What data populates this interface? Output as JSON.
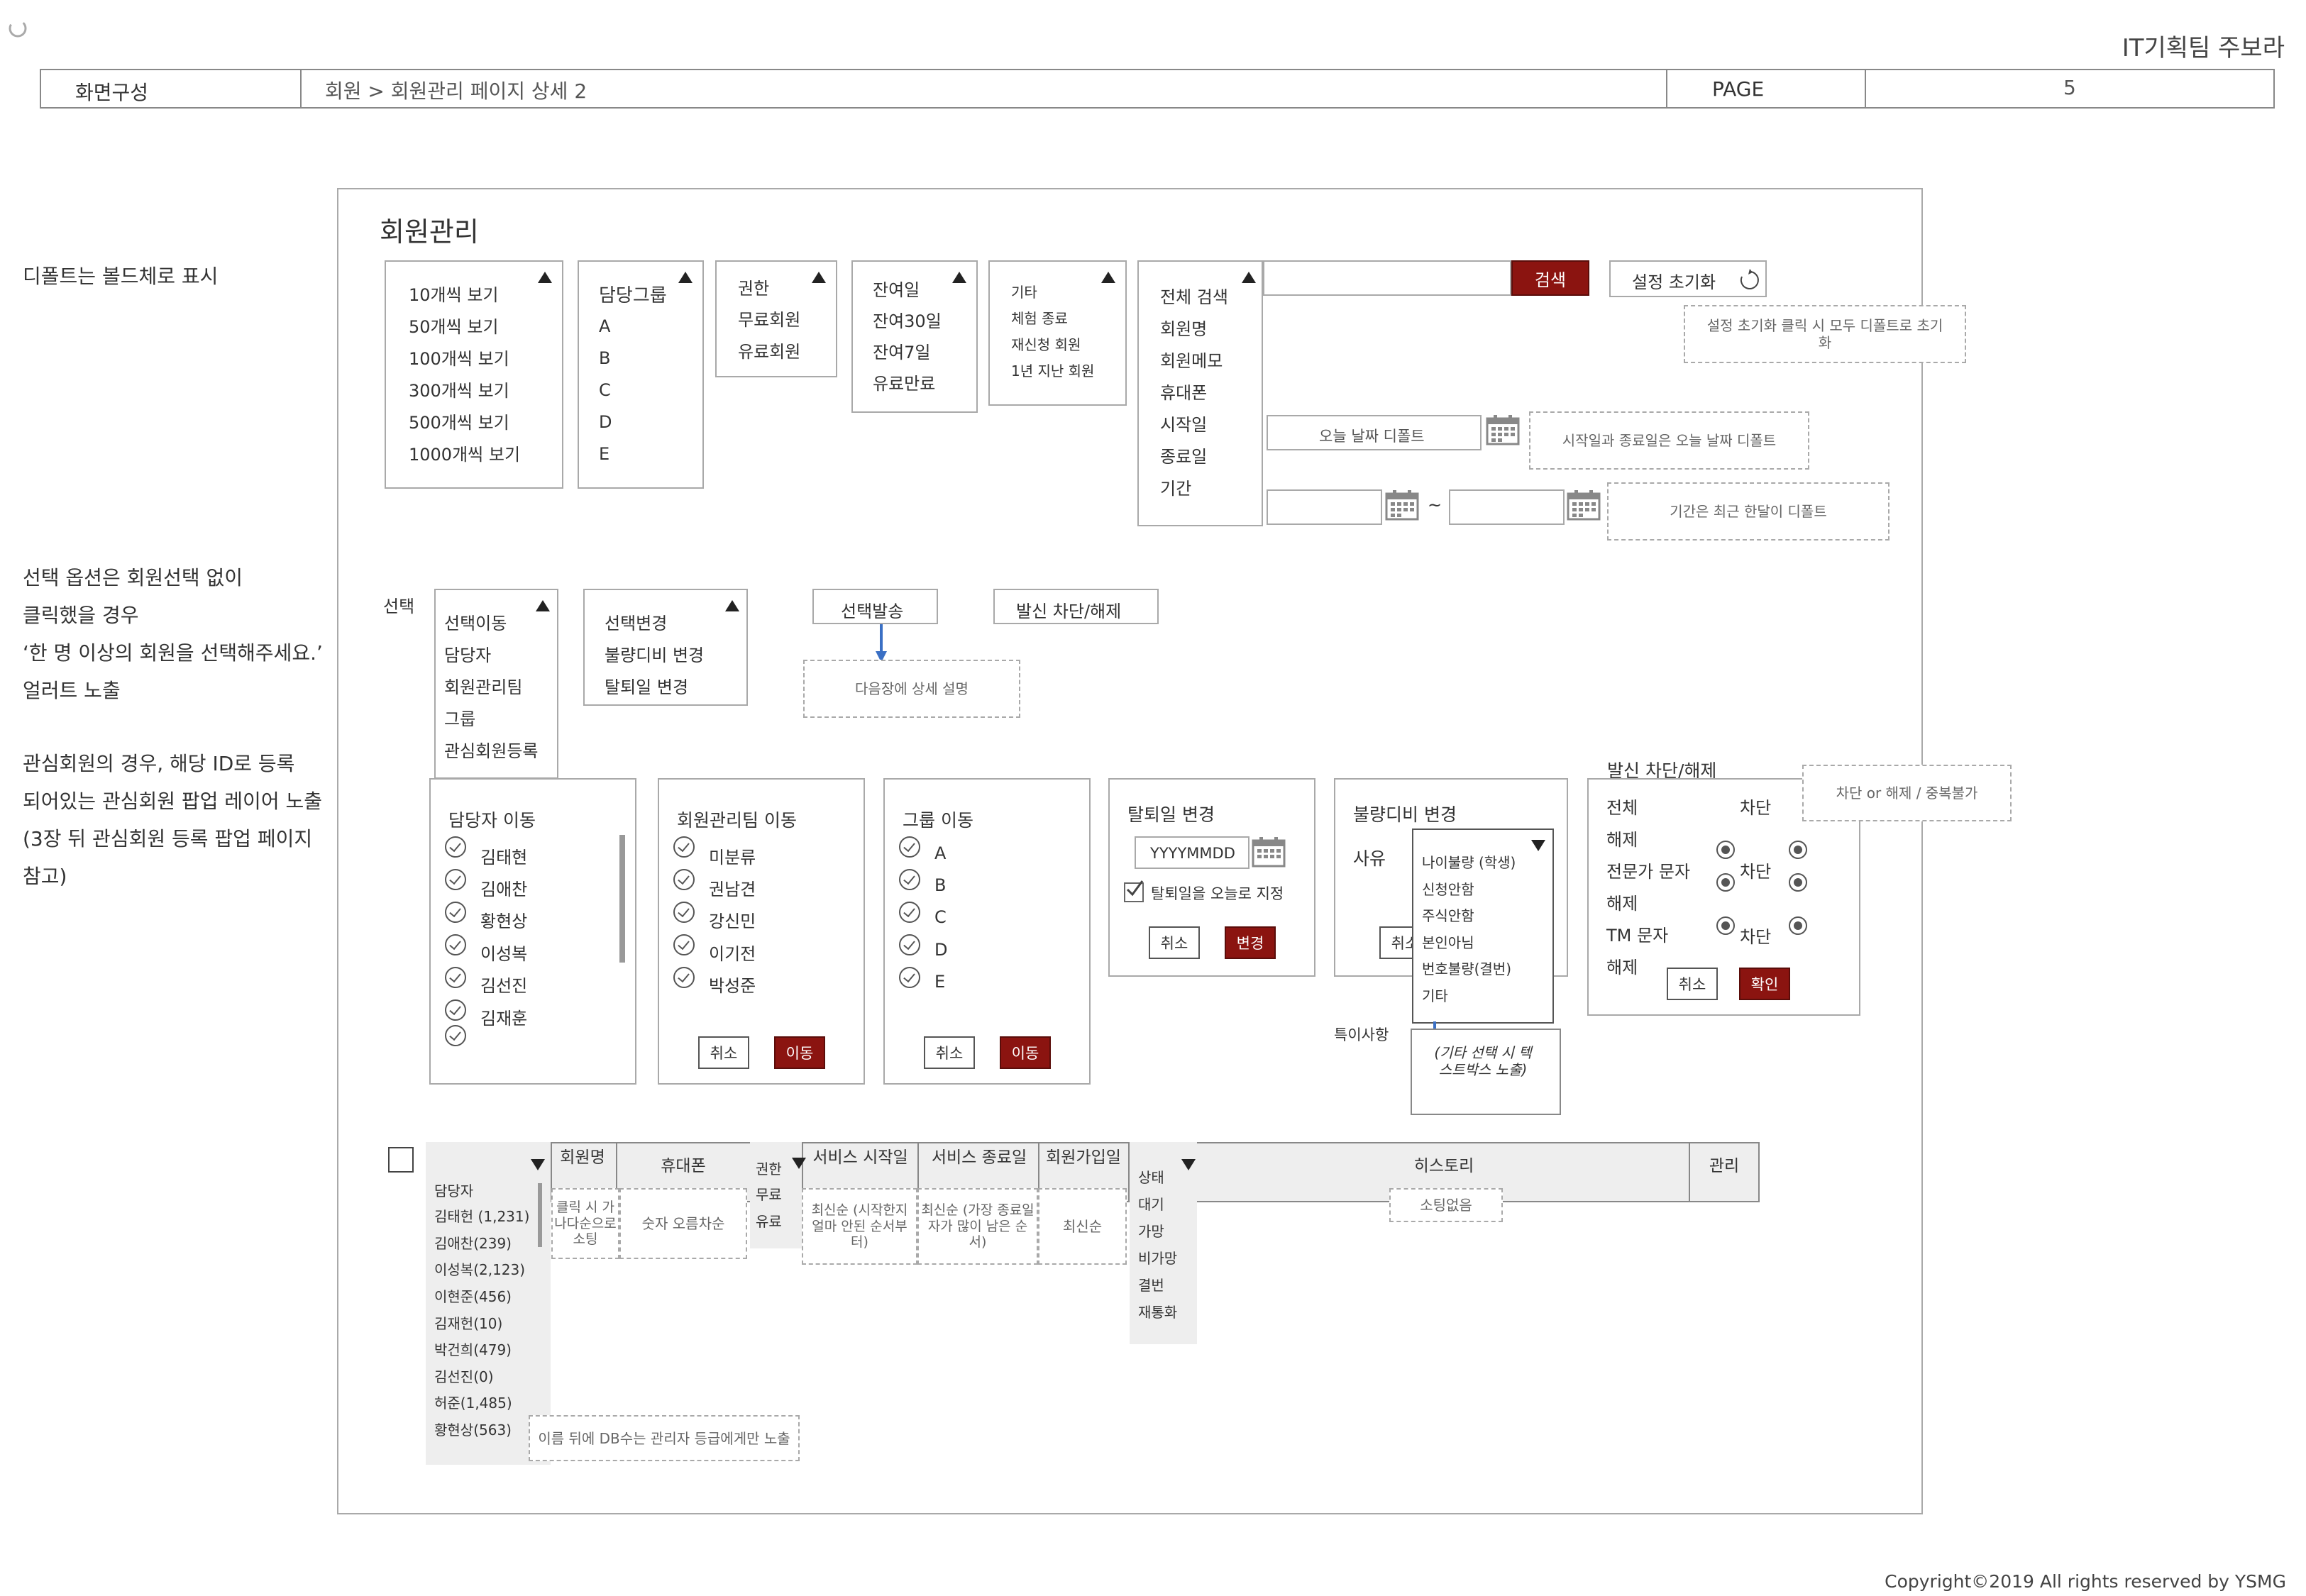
{
  "header": {
    "team": "IT기획팀 주보라",
    "screen_label": "화면구성",
    "breadcrumb": "회원 > 회원관리 페이지 상세 2",
    "page_label": "PAGE",
    "page_number": "5"
  },
  "notes": {
    "default_bold": "디폴트는 볼드체로 표시",
    "select_option": [
      "선택 옵션은 회원선택 없이",
      "클릭했을 경우",
      "‘한 명 이상의 회원을 선택해주세요.’",
      "얼러트 노출"
    ],
    "interest": [
      "관심회원의 경우, 해당 ID로 등록",
      "되어있는 관심회원 팝업 레이어 노출",
      "(3장 뒤 관심회원 등록 팝업 페이지",
      "참고)"
    ]
  },
  "panel_title": "회원관리",
  "filters": {
    "view_count": [
      "10개씩 보기",
      "50개씩 보기",
      "100개씩 보기",
      "300개씩 보기",
      "500개씩 보기",
      "1000개씩 보기"
    ],
    "group": [
      "담당그룹",
      "A",
      "B",
      "C",
      "D",
      "E"
    ],
    "auth": [
      "권한",
      "무료회원",
      "유료회원"
    ],
    "remaining": [
      "잔여일",
      "잔여30일",
      "잔여7일",
      "유료만료"
    ],
    "etc": [
      "기타",
      "체험 종료",
      "재신청 회원",
      "1년 지난 회원"
    ],
    "search_type": [
      "전체 검색",
      "회원명",
      "회원메모",
      "휴대폰",
      "시작일",
      "종료일",
      "기간"
    ],
    "search_button": "검색",
    "reset_button": "설정 초기화",
    "reset_note": "설정 초기화 클릭 시 모두 디폴트로 초기화",
    "today_default": "오늘 날짜 디폴트",
    "date_note": "시작일과 종료일은 오늘 날짜 디폴트",
    "tilde": "~",
    "period_note": "기간은 최근 한달이 디폴트"
  },
  "actions": {
    "select_label": "선택",
    "move_menu": [
      "선택이동",
      "담당자",
      "회원관리팀",
      "그룹",
      "관심회원등록"
    ],
    "change_menu": [
      "선택변경",
      "불량디비 변경",
      "탈퇴일 변경"
    ],
    "send_button": "선택발송",
    "send_note": "다음장에 상세 설명",
    "block_button": "발신 차단/해제"
  },
  "popups": {
    "manager": {
      "title": "담당자 이동",
      "items": [
        "김태현",
        "김애찬",
        "황현상",
        "이성복",
        "김선진",
        "김재훈",
        ""
      ]
    },
    "team": {
      "title": "회원관리팀 이동",
      "items": [
        "미분류",
        "권남견",
        "강신민",
        "이기전",
        "박성준"
      ],
      "cancel": "취소",
      "ok": "이동"
    },
    "group": {
      "title": "그룹 이동",
      "items": [
        "A",
        "B",
        "C",
        "D",
        "E"
      ],
      "cancel": "취소",
      "ok": "이동"
    },
    "withdraw": {
      "title": "탈퇴일 변경",
      "date_placeholder": "YYYYMMDD",
      "today_check": "탈퇴일을 오늘로 지정",
      "cancel": "취소",
      "ok": "변경"
    },
    "baddb": {
      "title": "불량디비 변경",
      "reason_label": "사유",
      "reasons": [
        "나이불량 (학생)",
        "신청안함",
        "주식안함",
        "본인아님",
        "번호불량(결번)",
        "기타"
      ],
      "cancel": "취소",
      "special_label": "특이사항",
      "special_text": "(기타 선택 시 텍스트박스 노출)"
    },
    "block": {
      "title": "발신 차단/해제",
      "note": "차단 or 해제 / 중복불가",
      "rows": [
        {
          "label": "전체",
          "block": "차단"
        },
        {
          "label": "해제"
        },
        {
          "label": "전문가 문자",
          "block": "차단"
        },
        {
          "label": "해제"
        },
        {
          "label": "TM 문자",
          "block": "차단"
        },
        {
          "label": "해제"
        }
      ],
      "cancel": "취소",
      "ok": "확인"
    }
  },
  "table": {
    "headers": [
      "담당자",
      "회원명",
      "휴대폰",
      "권한",
      "서비스 시작일",
      "서비스 종료일",
      "회원가입일",
      "상태",
      "히스토리",
      "관리"
    ],
    "managers": [
      "김태헌 (1,231)",
      "김애찬(239)",
      "이성복(2,123)",
      "이현준(456)",
      "김재헌(10)",
      "박건희(479)",
      "김선진(0)",
      "허준(1,485)",
      "황현상(563)"
    ],
    "manager_note": "이름 뒤에 DB수는 관리자 등급에게만 노출",
    "name_sort": "클릭 시 가나다순으로 소팅",
    "phone_sort": "숫자 오름차순",
    "auth_options": [
      "무료",
      "유료"
    ],
    "start_sort": "최신순 (시작한지 얼마 안된 순서부터)",
    "end_sort": "최신순 (가장 종료일자가 많이 남은 순서)",
    "join_sort": "최신순",
    "status_options": [
      "대기",
      "가망",
      "비가망",
      "결번",
      "재통화"
    ],
    "history_note": "소팅없음"
  },
  "footer": "Copyright©2019 All rights reserved by YSMG"
}
